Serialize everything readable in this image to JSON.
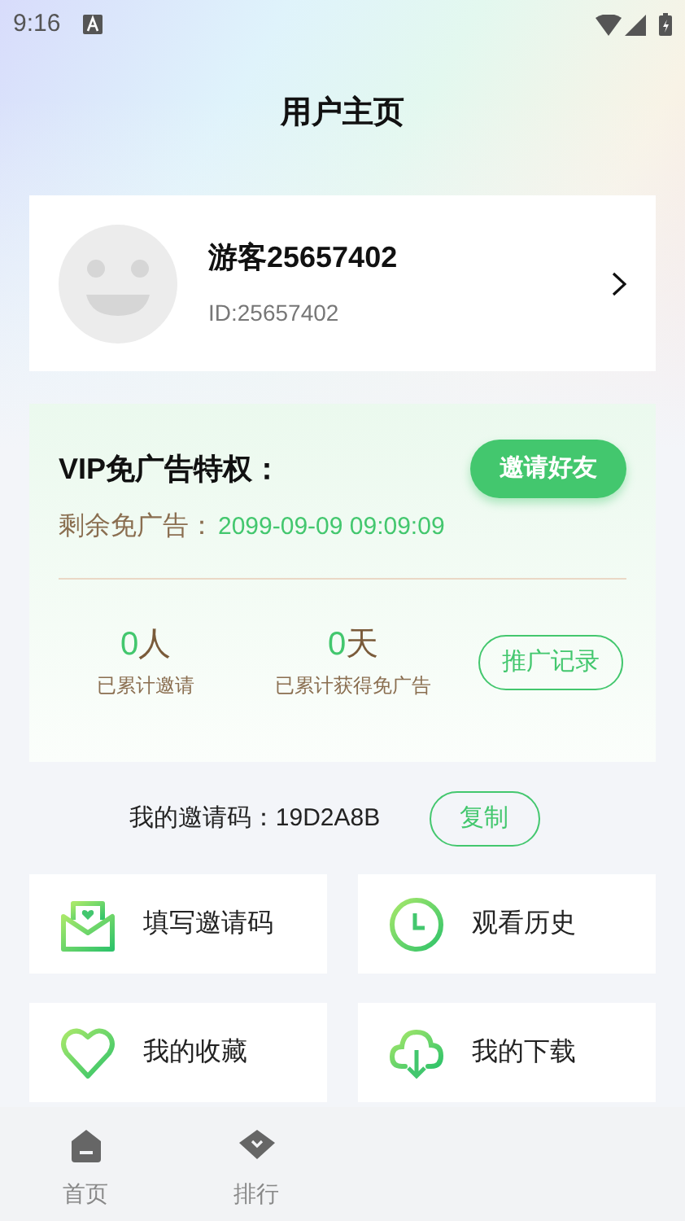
{
  "status_bar": {
    "time": "9:16"
  },
  "title": "用户主页",
  "profile": {
    "name": "游客25657402",
    "id": "ID:25657402"
  },
  "vip": {
    "title": "VIP免广告特权：",
    "invite_button": "邀请好友",
    "remaining_label": "剩余免广告：",
    "remaining_value": "2099-09-09 09:09:09",
    "stats": [
      {
        "value": "0",
        "unit": "人",
        "label": "已累计邀请"
      },
      {
        "value": "0",
        "unit": "天",
        "label": "已累计获得免广告"
      }
    ],
    "records_button": "推广记录"
  },
  "invite_code": {
    "label": "我的邀请码：",
    "code": "19D2A8B",
    "copy_button": "复制"
  },
  "menu": [
    {
      "kind": "envelope",
      "label": "填写邀请码"
    },
    {
      "kind": "clock",
      "label": "观看历史"
    },
    {
      "kind": "heart",
      "label": "我的收藏"
    },
    {
      "kind": "download",
      "label": "我的下载"
    }
  ],
  "tabs": [
    {
      "kind": "home",
      "label": "首页",
      "selected": false
    },
    {
      "kind": "rank",
      "label": "排行",
      "selected": false
    }
  ]
}
